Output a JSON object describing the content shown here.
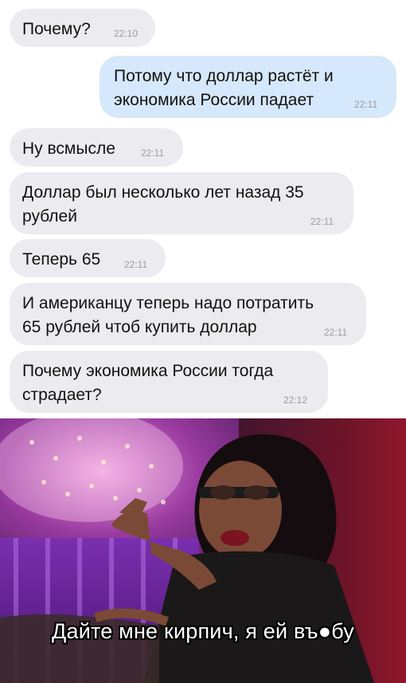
{
  "messages": [
    {
      "text": "Почему?",
      "time": "22:10"
    },
    {
      "text": "Потому что доллар растёт и экономика России падает",
      "time": "22:11"
    },
    {
      "text": "Ну всмысле",
      "time": "22:11"
    },
    {
      "text": "Доллар был несколько лет назад 35 рублей",
      "time": "22:11"
    },
    {
      "text": "Теперь 65",
      "time": "22:11"
    },
    {
      "text": "И американцу теперь надо потратить 65 рублей чтоб купить доллар",
      "time": "22:11"
    },
    {
      "text": "Почему экономика России тогда страдает?",
      "time": "22:12"
    }
  ],
  "meme": {
    "caption": "Дайте мне кирпич, я ей въ●бу"
  },
  "colors": {
    "incoming_bubble": "#ececf0",
    "outgoing_bubble": "#d6e8fb",
    "timestamp": "#9a9ba0"
  }
}
